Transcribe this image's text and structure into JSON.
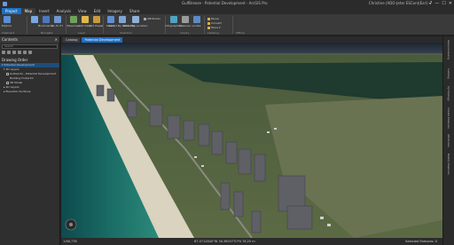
{
  "app": {
    "title": "GulfBreeze - Potential Development - ArcGIS Pro",
    "user": "Christine (ADO-Jeter ESCon)(Esri) ▾"
  },
  "window_controls": [
    "?",
    "—",
    "☐",
    "✕"
  ],
  "ribbon_tabs": [
    "Project",
    "Map",
    "Insert",
    "Analysis",
    "View",
    "Edit",
    "Imagery",
    "Share"
  ],
  "ribbon_tabs_active": "Map",
  "ribbon": {
    "buttons": [
      {
        "label": "Explore",
        "icon": "explore-icon"
      },
      {
        "label": "Bookmarks",
        "icon": "bookmark-icon"
      },
      {
        "label": "Go To XY",
        "icon": "goto-xy-icon"
      },
      {
        "label": "Basemap",
        "icon": "basemap-icon"
      },
      {
        "label": "Add Data",
        "icon": "add-data-icon"
      },
      {
        "label": "Add Preset",
        "icon": "add-preset-icon"
      },
      {
        "label": "Select",
        "icon": "select-icon"
      },
      {
        "label": "Select By Attributes",
        "icon": "select-attributes-icon"
      },
      {
        "label": "Select By Location",
        "icon": "select-location-icon"
      },
      {
        "label": "Infographics",
        "icon": "infographics-icon"
      },
      {
        "label": "Measure",
        "icon": "measure-icon"
      },
      {
        "label": "Locate",
        "icon": "locate-icon"
      }
    ],
    "small_buttons": {
      "attributes": "Attributes",
      "pause": "Pause",
      "convert": "Convert",
      "move": "Move ▾"
    },
    "groups": [
      "Clipboard",
      "Navigate",
      "Layer",
      "Selection",
      "Inquiry",
      "Labeling",
      "Offline"
    ]
  },
  "contents": {
    "title": "Contents",
    "search_placeholder": "Search",
    "drawing_order": "Drawing Order",
    "items": [
      {
        "label": "Potential Development",
        "selected": true
      },
      {
        "label": "3D Layers",
        "selected": false
      },
      {
        "label": "Gulfworks - Potential Development",
        "selected": false
      },
      {
        "label": "Building Footprint",
        "selected": false
      },
      {
        "label": "3D Model",
        "selected": false
      },
      {
        "label": "2D Layers",
        "selected": false
      },
      {
        "label": "Elevation Surfaces",
        "selected": false
      }
    ]
  },
  "view_tabs": [
    {
      "label": "Catalog",
      "active": false
    },
    {
      "label": "Potential Development",
      "active": true
    }
  ],
  "side_panels": [
    "Geoprocessing",
    "Catalog",
    "Symbology",
    "Create Features",
    "Attributes",
    "Modify Features"
  ],
  "status": {
    "scale": "1:88,778",
    "coordinates": "87.0712840°W 30.3603770°N  76.25 m",
    "selected": "Selected Features: 0"
  },
  "colors": {
    "accent": "#1f6fc2",
    "ribbon": "#3a3a3a",
    "titlebar": "#2b2b2b"
  }
}
